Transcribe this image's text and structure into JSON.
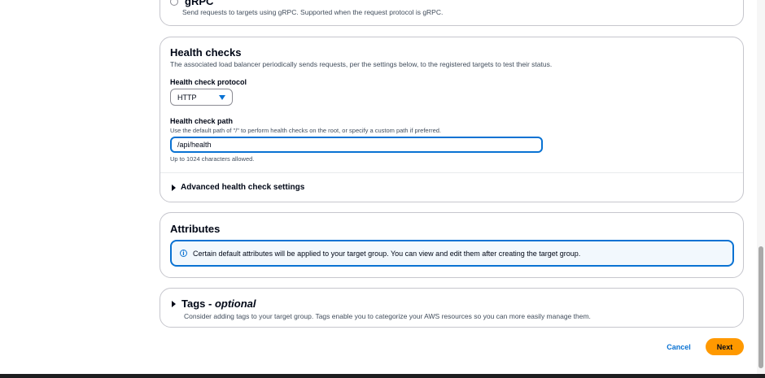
{
  "protocol_option": {
    "label": "gRPC",
    "description": "Send requests to targets using gRPC. Supported when the request protocol is gRPC."
  },
  "health_checks": {
    "title": "Health checks",
    "description": "The associated load balancer periodically sends requests, per the settings below, to the registered targets to test their status.",
    "protocol_label": "Health check protocol",
    "protocol_value": "HTTP",
    "path_label": "Health check path",
    "path_hint": "Use the default path of \"/\" to perform health checks on the root, or specify a custom path if preferred.",
    "path_value": "/api/health",
    "path_constraint": "Up to 1024 characters allowed.",
    "advanced_label": "Advanced health check settings"
  },
  "attributes": {
    "title": "Attributes",
    "info_text": "Certain default attributes will be applied to your target group. You can view and edit them after creating the target group."
  },
  "tags": {
    "title": "Tags -",
    "optional": "optional",
    "description": "Consider adding tags to your target group. Tags enable you to categorize your AWS resources so you can more easily manage them."
  },
  "actions": {
    "cancel": "Cancel",
    "next": "Next"
  },
  "colors": {
    "accent": "#0972d3",
    "primary_button": "#ff9900",
    "border": "#c6c6cd"
  },
  "icons": [
    "radio-icon",
    "caret-down-icon",
    "triangle-right-icon",
    "info-icon"
  ]
}
